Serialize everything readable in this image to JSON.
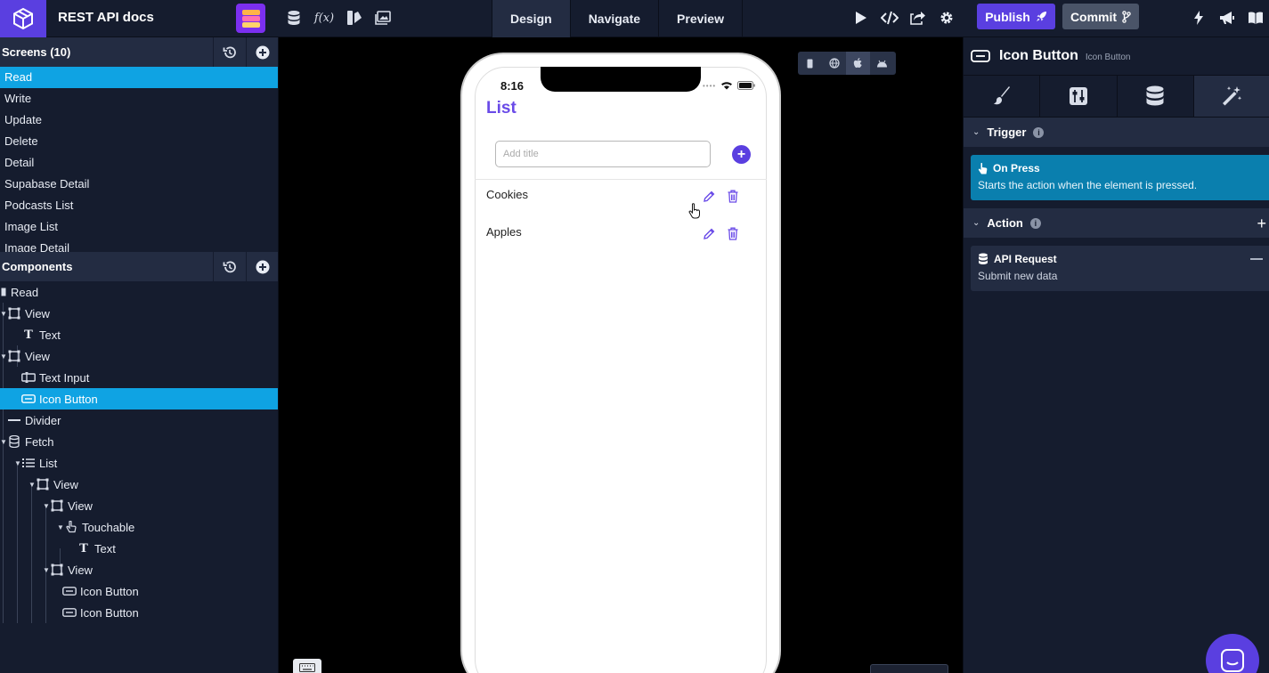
{
  "app": {
    "title": "REST API docs"
  },
  "topbar": {
    "tabs": [
      {
        "label": "Design"
      },
      {
        "label": "Navigate"
      },
      {
        "label": "Preview"
      }
    ],
    "publish_label": "Publish",
    "commit_label": "Commit"
  },
  "screens": {
    "header": "Screens (10)",
    "items": [
      {
        "label": "Read"
      },
      {
        "label": "Write"
      },
      {
        "label": "Update"
      },
      {
        "label": "Delete"
      },
      {
        "label": "Detail"
      },
      {
        "label": "Supabase Detail"
      },
      {
        "label": "Podcasts List"
      },
      {
        "label": "Image List"
      },
      {
        "label": "Image Detail"
      }
    ]
  },
  "components": {
    "header": "Components",
    "tree": [
      {
        "label": "Read"
      },
      {
        "label": "View"
      },
      {
        "label": "Text"
      },
      {
        "label": "View"
      },
      {
        "label": "Text Input"
      },
      {
        "label": "Icon Button"
      },
      {
        "label": "Divider"
      },
      {
        "label": "Fetch"
      },
      {
        "label": "List"
      },
      {
        "label": "View"
      },
      {
        "label": "View"
      },
      {
        "label": "Touchable"
      },
      {
        "label": "Text"
      },
      {
        "label": "View"
      },
      {
        "label": "Icon Button"
      },
      {
        "label": "Icon Button"
      }
    ]
  },
  "phone": {
    "time": "8:16",
    "title": "List",
    "input_placeholder": "Add title",
    "items": [
      {
        "label": "Cookies"
      },
      {
        "label": "Apples"
      }
    ]
  },
  "inspector": {
    "title": "Icon Button",
    "subtitle": "Icon Button",
    "trigger_header": "Trigger",
    "trigger_title": "On Press",
    "trigger_desc": "Starts the action when the element is pressed.",
    "action_header": "Action",
    "action_title": "API Request",
    "action_desc": "Submit new data"
  },
  "colors": {
    "accent": "#5a3fe0",
    "selection": "#0fa3e3",
    "panel": "#151c2e",
    "trigger_card": "#0a7fae"
  }
}
